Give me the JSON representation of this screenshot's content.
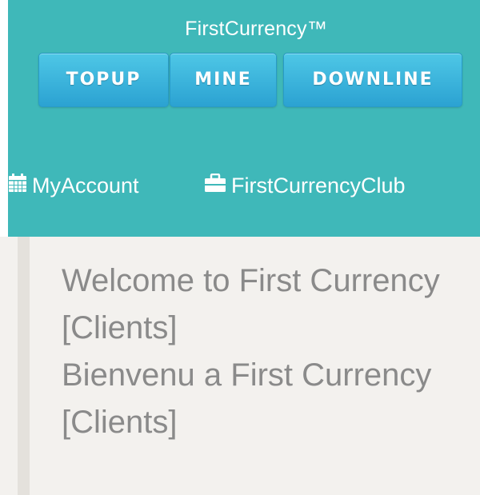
{
  "header": {
    "brand": "FirstCurrency™",
    "buttons": {
      "topup": "TOPUP",
      "mine": "MINE",
      "downline": "DOWNLINE"
    },
    "links": {
      "myaccount": "MyAccount",
      "club": "FirstCurrencyClub"
    }
  },
  "content": {
    "welcome_en": "Welcome to First Currency [Clients]",
    "welcome_fr": "Bienvenu a First Currency [Clients]"
  },
  "colors": {
    "header_bg": "#3fb8b9",
    "button_bg": "#2ba2d2",
    "content_bg": "#f3f1ee",
    "text_gray": "#8a8a8a"
  },
  "icons": {
    "myaccount": "calendar-icon",
    "club": "briefcase-icon"
  }
}
